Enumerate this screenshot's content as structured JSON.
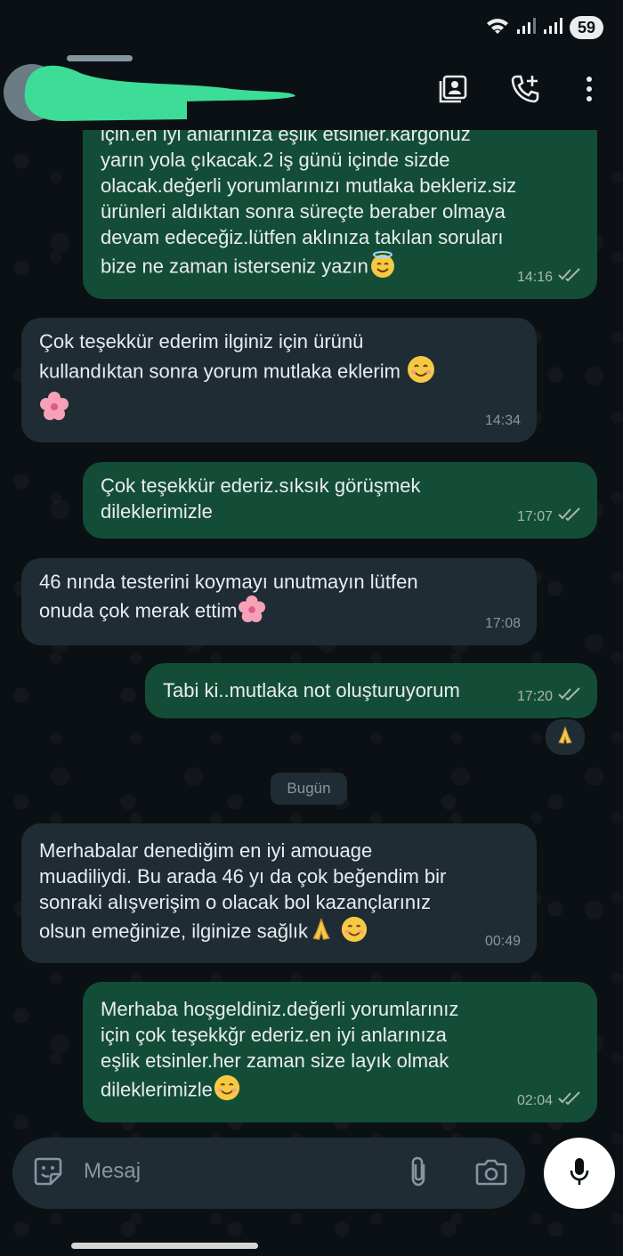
{
  "status_bar": {
    "battery": "59"
  },
  "header": {
    "contact_name_redacted": true,
    "icons": [
      "contact-card-icon",
      "add-call-icon",
      "more-vert-icon"
    ]
  },
  "messages": [
    {
      "direction": "out",
      "lines": [
        "için.en iyi anlarınıza eşlik etsinler.kargonuz",
        "yarın yola çıkacak.2 iş günü içinde sizde",
        "olacak.değerli yorumlarınızı mutlaka bekleriz.siz",
        "ürünleri aldıktan sonra süreçte beraber olmaya",
        "devam edeceğiz.lütfen aklınıza takılan soruları",
        "bize ne zaman isterseniz yazın"
      ],
      "time": "14:16",
      "read": true
    },
    {
      "direction": "in",
      "lines": [
        "Çok teşekkür ederim ilginiz için ürünü",
        "kullandıktan sonra yorum mutlaka eklerim"
      ],
      "time": "14:34"
    },
    {
      "direction": "out",
      "lines": [
        "Çok teşekkür ederiz.sıksık görüşmek",
        "dileklerimizle"
      ],
      "time": "17:07",
      "read": true
    },
    {
      "direction": "in",
      "lines": [
        "46 nında testerini koymayı unutmayın lütfen",
        "onuda çok merak ettim"
      ],
      "time": "17:08"
    },
    {
      "direction": "out",
      "lines": [
        "Tabi ki..mutlaka not oluşturuyorum"
      ],
      "time": "17:20",
      "read": true,
      "reaction": "🙏"
    },
    {
      "direction": "in",
      "lines": [
        "Merhabalar denediğim en iyi amouage",
        "muadiliydi. Bu arada 46 yı da çok beğendim bir",
        "sonraki alışverişim o olacak bol kazançlarınız",
        "olsun emeğinize, ilginize sağlık"
      ],
      "time": "00:49"
    },
    {
      "direction": "out",
      "lines": [
        "Merhaba hoşgeldiniz.değerli yorumlarınız",
        "için çok teşekkğr ederiz.en iyi anlarınıza",
        "eşlik etsinler.her zaman size layık olmak",
        "dileklerimizle"
      ],
      "time": "02:04",
      "read": true
    }
  ],
  "date_separator": "Bugün",
  "input": {
    "placeholder": "Mesaj"
  },
  "colors": {
    "outgoing": "#144d37",
    "incoming": "#1f2c34",
    "background": "#0b1014"
  }
}
